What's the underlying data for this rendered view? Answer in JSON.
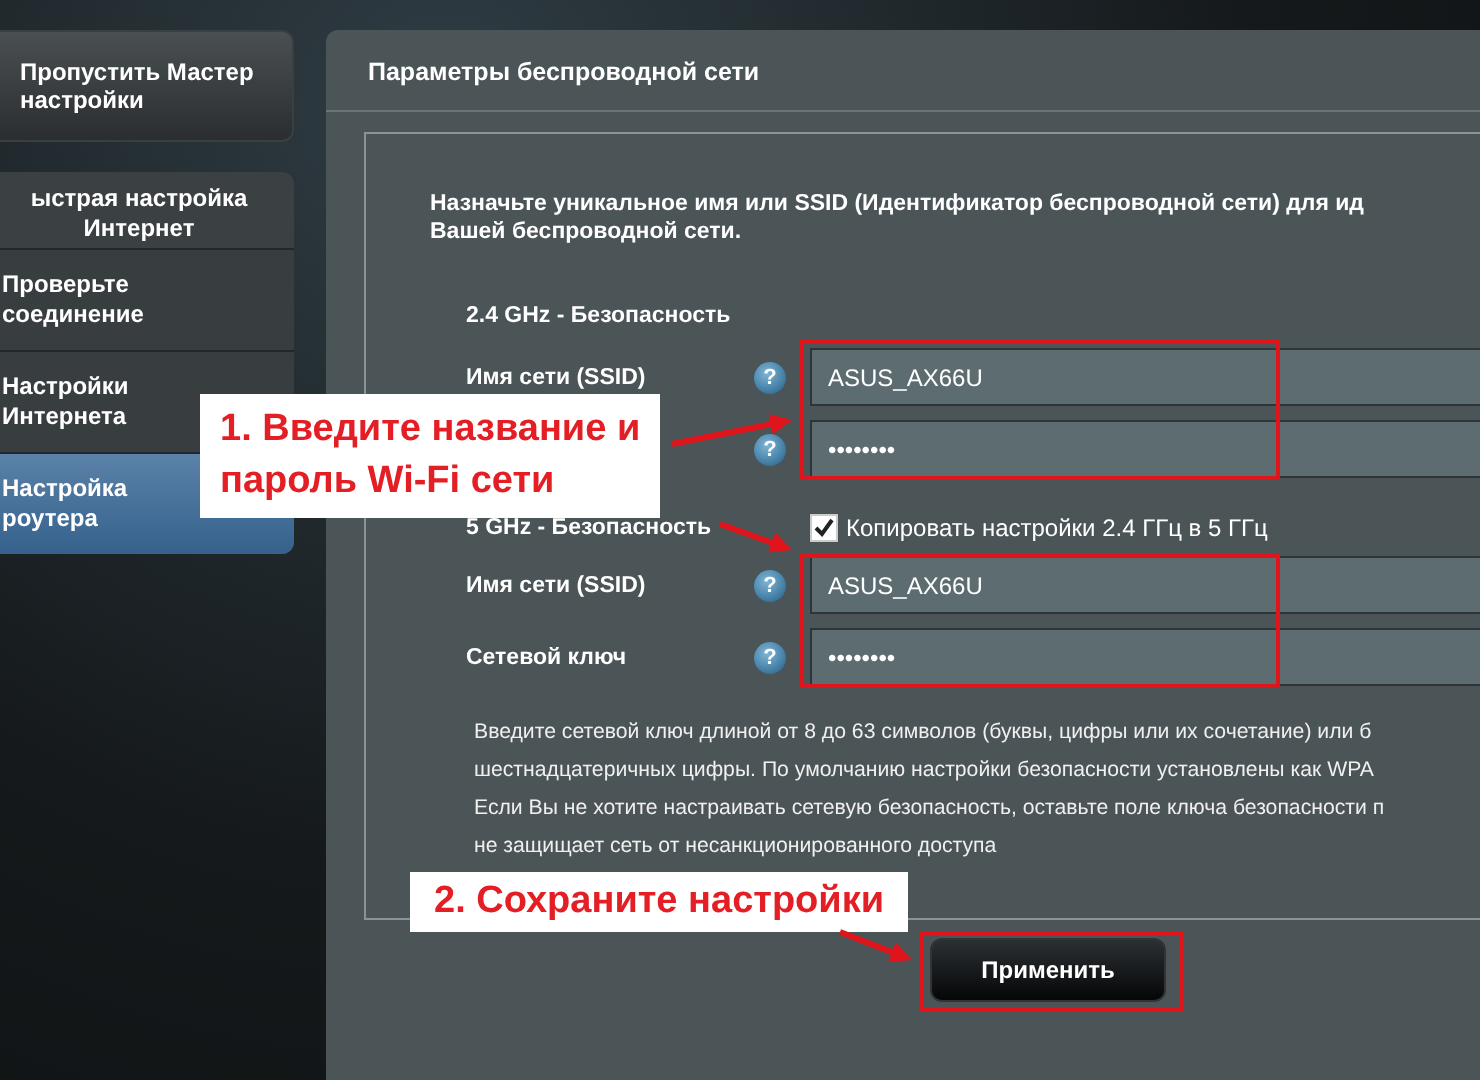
{
  "sidebar": {
    "wizard_button": "Пропустить Мастер настройки",
    "section_title": [
      "ыстрая настройка",
      "Интернет"
    ],
    "items": [
      {
        "label": "Проверьте соединение",
        "selected": false
      },
      {
        "label": "Настройки Интернета",
        "selected": false
      },
      {
        "label": "Настройка роутера",
        "selected": true
      }
    ]
  },
  "panel": {
    "title": "Параметры беспроводной сети",
    "intro": [
      "Назначьте уникальное имя или SSID (Идентификатор беспроводной сети) для ид",
      "Вашей беспроводной сети."
    ],
    "bands": [
      {
        "title": "2.4 GHz - Безопасность",
        "fields": [
          {
            "label": "Имя сети (SSID)",
            "help": "?",
            "value": "ASUS_AX66U"
          },
          {
            "help": "?",
            "value": "••••••••"
          }
        ]
      },
      {
        "title": "5 GHz - Безопасность",
        "copy_checkbox": {
          "label": "Копировать настройки 2.4 ГГц в 5 ГГц",
          "checked": true
        },
        "fields": [
          {
            "label": "Имя сети (SSID)",
            "help": "?",
            "value": "ASUS_AX66U"
          },
          {
            "label": "Сетевой ключ",
            "help": "?",
            "value": "••••••••"
          }
        ]
      }
    ],
    "help_lines": [
      "Введите сетевой ключ длиной от 8 до 63 символов (буквы, цифры или их сочетание) или б",
      "шестнадцатеричных цифры. По умолчанию настройки безопасности установлены как WPA",
      "Если Вы не хотите настраивать сетевую безопасность, оставьте поле ключа безопасности п",
      "не защищает сеть от несанкционированного доступа"
    ],
    "apply_button": "Применить"
  },
  "annotations": [
    {
      "lines": [
        "1. Введите название и",
        "пароль Wi-Fi сети"
      ]
    },
    {
      "lines": [
        "2. Сохраните настройки"
      ]
    }
  ]
}
